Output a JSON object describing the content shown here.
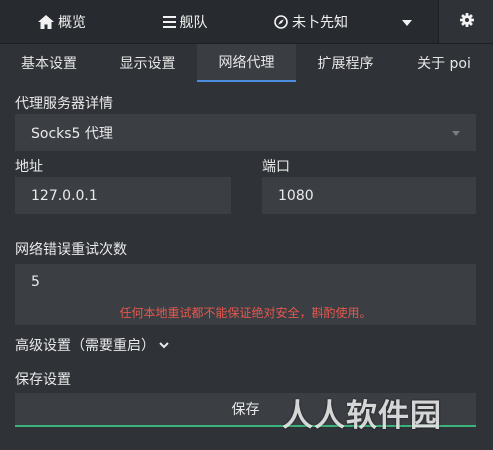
{
  "topnav": {
    "overview": "概览",
    "fleet": "舰队",
    "plugin": "未卜先知"
  },
  "tabs": [
    "基本设置",
    "显示设置",
    "网络代理",
    "扩展程序",
    "关于 poi"
  ],
  "proxy": {
    "section_title": "代理服务器详情",
    "type_selected": "Socks5 代理",
    "address_label": "地址",
    "address_value": "127.0.0.1",
    "port_label": "端口",
    "port_value": "1080"
  },
  "retry": {
    "label": "网络错误重试次数",
    "value": "5",
    "warning": "任何本地重试都不能保证绝对安全，斟酌使用。"
  },
  "advanced": {
    "label": "高级设置（需要重启）"
  },
  "save": {
    "section_label": "保存设置",
    "button_label": "保存"
  },
  "watermark": "人人软件园",
  "colors": {
    "active_tab_underline": "#4c8dde",
    "save_underline": "#3cb37a",
    "warning_text": "#e5584e"
  }
}
